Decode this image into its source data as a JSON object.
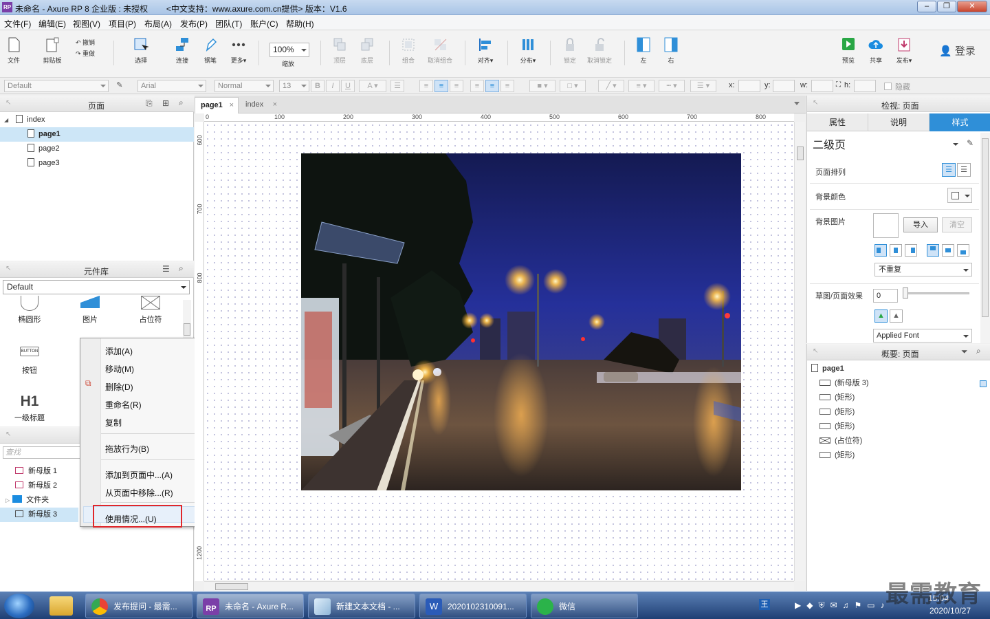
{
  "title_bar": {
    "app_icon": "RP",
    "title": "未命名 - Axure RP 8 企业版 : 未授权        <中文支持：www.axure.com.cn提供> 版本：V1.6"
  },
  "menu": [
    "文件(F)",
    "编辑(E)",
    "视图(V)",
    "项目(P)",
    "布局(A)",
    "发布(P)",
    "团队(T)",
    "账户(C)",
    "帮助(H)"
  ],
  "toolbar": {
    "file": "文件",
    "clipboard": "剪贴板",
    "undo": "撤销",
    "redo": "重做",
    "select": "选择",
    "connect": "连接",
    "pen": "钢笔",
    "more": "更多▾",
    "zoom_value": "100%",
    "zoom_label": "缩放",
    "top": "顶层",
    "bottom": "底层",
    "group": "组合",
    "ungroup": "取消组合",
    "align": "对齐▾",
    "distribute": "分布▾",
    "lock": "锁定",
    "unlock": "取消锁定",
    "left": "左",
    "right": "右",
    "preview": "预览",
    "share": "共享",
    "publish": "发布▾",
    "login": "登录"
  },
  "format_bar": {
    "style": "Default",
    "font": "Arial",
    "weight": "Normal",
    "size": "13",
    "x_label": "x:",
    "y_label": "y:",
    "w_label": "w:",
    "h_label": "h:",
    "hidden_label": "隐藏"
  },
  "pages_panel": {
    "title": "页面",
    "items": [
      {
        "label": "index",
        "level": 0
      },
      {
        "label": "page1",
        "level": 1,
        "selected": true
      },
      {
        "label": "page2",
        "level": 1
      },
      {
        "label": "page3",
        "level": 1
      }
    ]
  },
  "library_panel": {
    "title": "元件库",
    "selected_library": "Default",
    "widgets": [
      "椭圆形",
      "图片",
      "占位符",
      "按钮",
      "一级标题"
    ],
    "button_text": "BUTTON",
    "h1_text": "H1"
  },
  "masters_panel": {
    "search_placeholder": "查找",
    "items": [
      "新母版 1",
      "新母版 2",
      "文件夹",
      "新母版 3"
    ]
  },
  "context_menu": {
    "items": [
      "添加(A)",
      "移动(M)",
      "删除(D)",
      "重命名(R)",
      "复制",
      "拖放行为(B)",
      "添加到页面中...(A)",
      "从页面中移除...(R)",
      "使用情况...(U)"
    ],
    "highlighted": "使用情况...(U)"
  },
  "editor": {
    "tabs": [
      "page1",
      "index"
    ],
    "active_tab": "page1",
    "h_ruler": [
      "0",
      "100",
      "200",
      "300",
      "400",
      "500",
      "600",
      "700",
      "800"
    ],
    "v_ruler": [
      "600",
      "700",
      "800",
      "1200"
    ]
  },
  "inspector": {
    "title": "检视: 页面",
    "tabs": [
      "属性",
      "说明",
      "样式"
    ],
    "active_tab": "样式",
    "page_style": "二级页",
    "page_align_label": "页面排列",
    "bg_color_label": "背景颜色",
    "bg_image_label": "背景图片",
    "import_button": "导入",
    "clear_button": "清空",
    "repeat_value": "不重复",
    "sketch_label": "草图/页面效果",
    "sketch_value": "0",
    "font_value": "Applied Font"
  },
  "outline": {
    "title": "概要: 页面",
    "root": "page1",
    "items": [
      "(新母版 3)",
      "(矩形)",
      "(矩形)",
      "(矩形)",
      "(占位符)",
      "(矩形)"
    ]
  },
  "taskbar": {
    "tasks": [
      "发布提问 - 最需...",
      "未命名 - Axure R...",
      "新建文本文档 - ...",
      "2020102310091...",
      "微信"
    ],
    "clock_time": "15:04",
    "clock_date": "2020/10/27",
    "watermark": "最需教育"
  },
  "colors": {
    "accent": "#2f8fd8",
    "selection": "#cde6f7",
    "highlight_border": "#e0262a"
  }
}
